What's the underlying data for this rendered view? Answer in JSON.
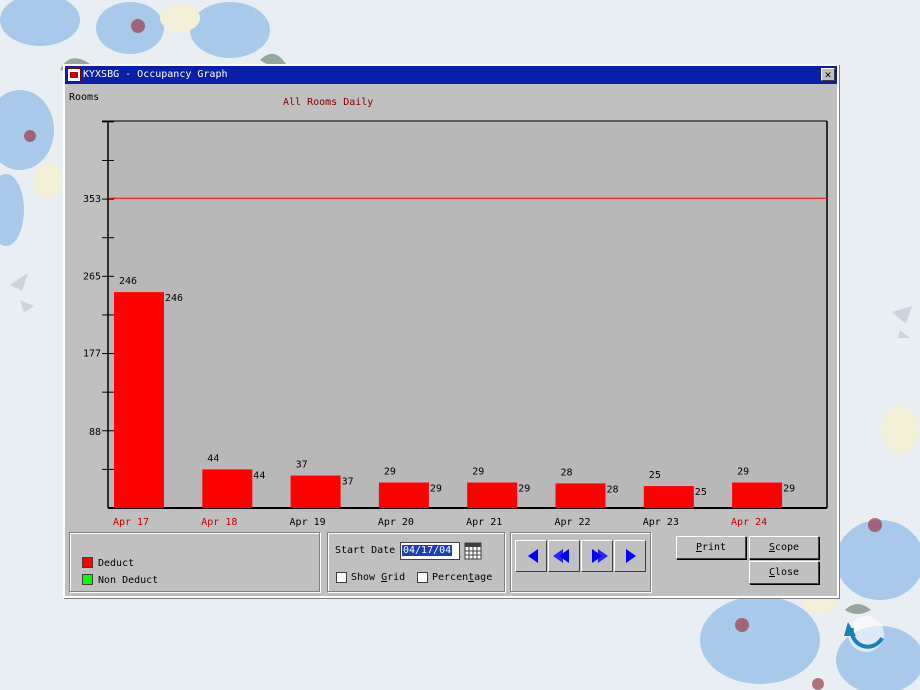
{
  "window": {
    "title": "KYXSBG - Occupancy Graph",
    "close_glyph": "✕"
  },
  "chart_data": {
    "type": "bar",
    "title": "All Rooms Daily",
    "ylabel": "Rooms",
    "categories": [
      "Apr 17",
      "Apr 18",
      "Apr 19",
      "Apr 20",
      "Apr 21",
      "Apr 22",
      "Apr 23",
      "Apr 24"
    ],
    "category_colors": [
      "#c00000",
      "#c00000",
      "#000000",
      "#000000",
      "#000000",
      "#000000",
      "#000000",
      "#c00000"
    ],
    "series": [
      {
        "name": "Deduct",
        "color": "#ff0000",
        "values": [
          246,
          44,
          37,
          29,
          29,
          28,
          25,
          29
        ]
      }
    ],
    "value_labels": {
      "above": [
        "246",
        "44",
        "37",
        "29",
        "29",
        "28",
        "25",
        "29"
      ],
      "right": [
        "246",
        "44",
        "37",
        "29",
        "29",
        "28",
        "25",
        "29"
      ]
    },
    "yticks": [
      "88",
      "177",
      "265",
      "353"
    ],
    "ytick_values": [
      88,
      177,
      265,
      353
    ],
    "ylim": [
      0,
      441
    ],
    "capacity_line": 353,
    "capacity_line_color": "#ff0000",
    "grid": false
  },
  "legend": {
    "items": [
      {
        "label": "Deduct",
        "color": "#ff0000"
      },
      {
        "label": "Non Deduct",
        "color": "#00ff00"
      }
    ]
  },
  "controls": {
    "start_date_label": "Start Date",
    "start_date_value": "04/17/04",
    "show_grid_label_pre": "Show ",
    "show_grid_label_key": "G",
    "show_grid_label_post": "rid",
    "show_grid_checked": false,
    "percentage_label_pre": "Percen",
    "percentage_label_key": "t",
    "percentage_label_post": "age",
    "percentage_checked": false
  },
  "nav_buttons": [
    {
      "icon": "first-icon"
    },
    {
      "icon": "rewind-icon"
    },
    {
      "icon": "fast-forward-icon"
    },
    {
      "icon": "next-icon"
    }
  ],
  "actions": {
    "print_key": "P",
    "print_rest": "rint",
    "scope_key": "S",
    "scope_rest": "cope",
    "close_key": "C",
    "close_rest": "lose"
  }
}
